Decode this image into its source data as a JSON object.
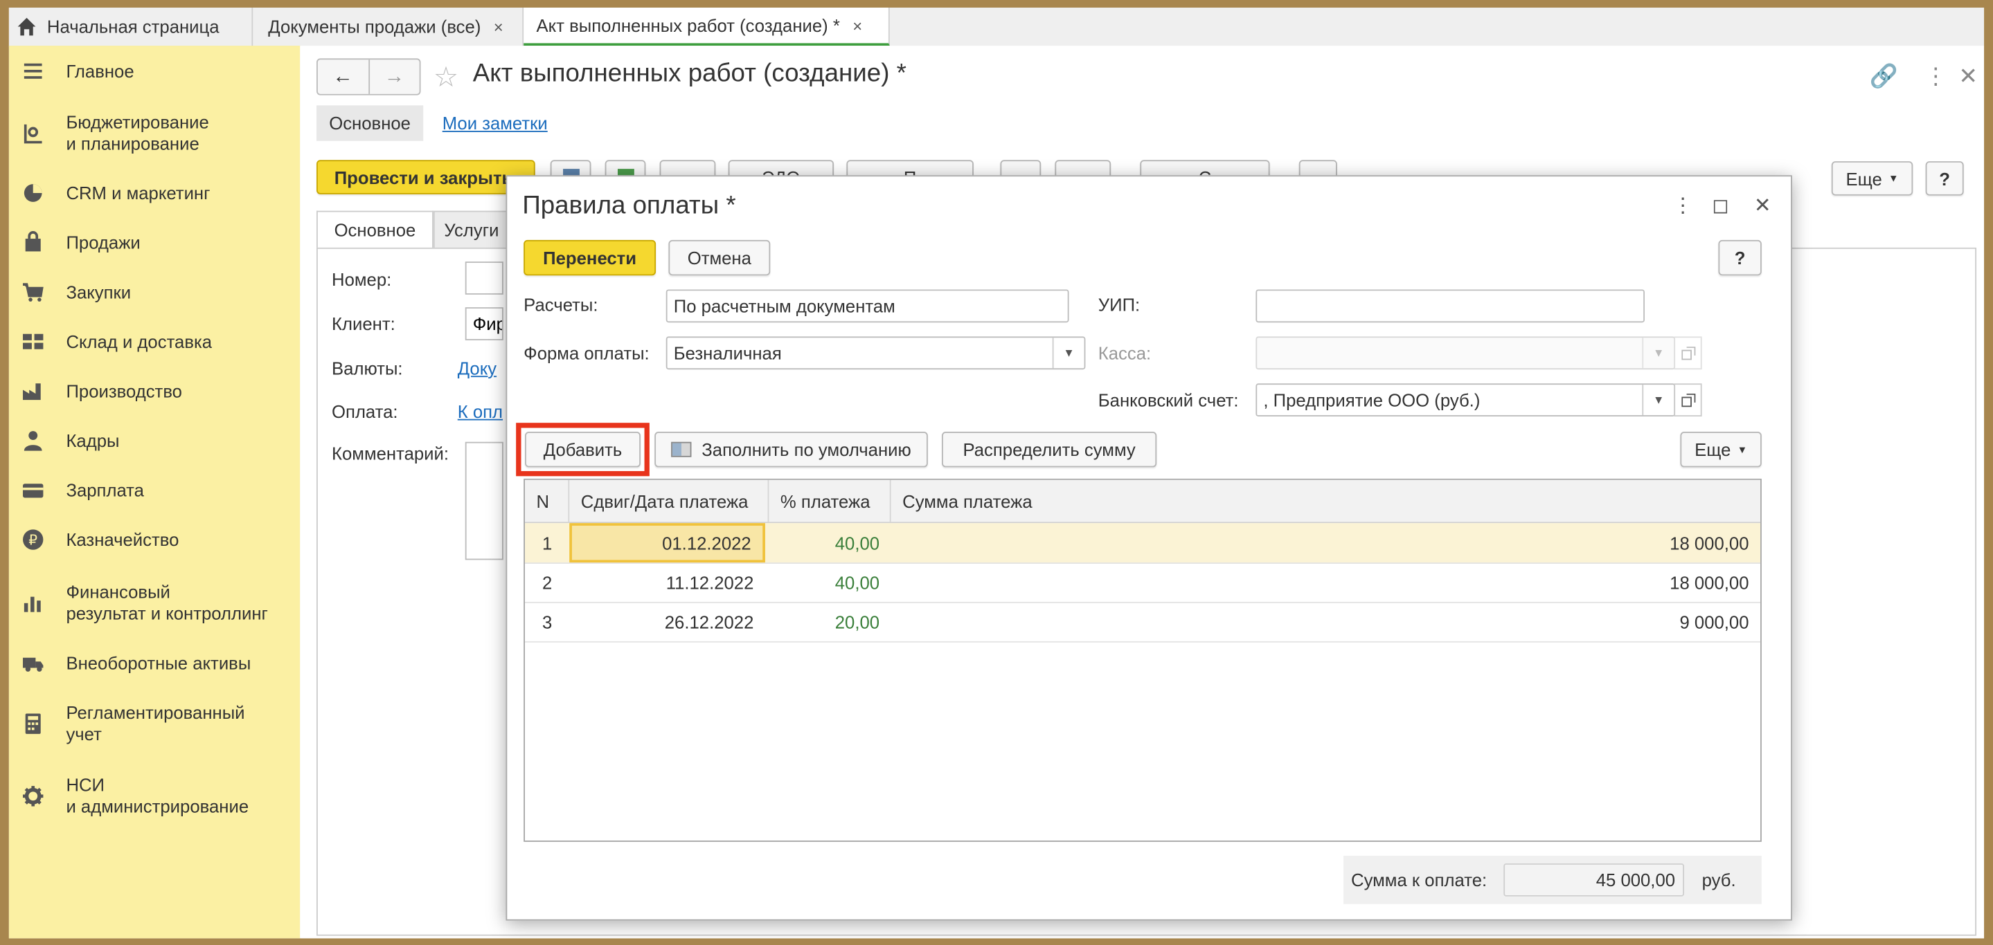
{
  "tabs": [
    {
      "label": "Начальная страница"
    },
    {
      "label": "Документы продажи (все)",
      "close": "×"
    },
    {
      "label": "Акт выполненных работ (создание) *",
      "close": "×"
    }
  ],
  "sidebar": {
    "items": [
      {
        "label": "Главное",
        "icon": "menu-icon"
      },
      {
        "label": "Бюджетирование\nи планирование",
        "icon": "budget-icon"
      },
      {
        "label": "CRM и маркетинг",
        "icon": "pie-chart-icon"
      },
      {
        "label": "Продажи",
        "icon": "bag-icon"
      },
      {
        "label": "Закупки",
        "icon": "cart-icon"
      },
      {
        "label": "Склад и доставка",
        "icon": "warehouse-icon"
      },
      {
        "label": "Производство",
        "icon": "factory-icon"
      },
      {
        "label": "Кадры",
        "icon": "person-icon"
      },
      {
        "label": "Зарплата",
        "icon": "card-icon"
      },
      {
        "label": "Казначейство",
        "icon": "ruble-icon"
      },
      {
        "label": "Финансовый\nрезультат и контроллинг",
        "icon": "bar-chart-icon"
      },
      {
        "label": "Внеоборотные активы",
        "icon": "truck-icon"
      },
      {
        "label": "Регламентированный\nучет",
        "icon": "calculator-icon"
      },
      {
        "label": "НСИ\nи администрирование",
        "icon": "gear-icon"
      }
    ]
  },
  "document": {
    "title": "Акт выполненных работ (создание) *",
    "subtabs": {
      "main": "Основное",
      "notes": "Мои заметки"
    },
    "post_and_close": "Провести и закрыть",
    "more": "Еще",
    "help": "?",
    "form_tabs": [
      "Основное",
      "Услуги"
    ],
    "fields": {
      "number_label": "Номер:",
      "client_label": "Клиент:",
      "client_value": "Фир",
      "currency_label": "Валюты:",
      "currency_value": "Доку",
      "payment_label": "Оплата:",
      "payment_value": "К опл",
      "comment_label": "Комментарий:"
    },
    "toolbar_partial": {
      "edo": "ЭДО",
      "print": "П",
      "create": "С"
    }
  },
  "modal": {
    "title": "Правила оплаты *",
    "transfer": "Перенести",
    "cancel": "Отмена",
    "help": "?",
    "settlements_label": "Расчеты:",
    "settlements_value": "По расчетным документам",
    "uip_label": "УИП:",
    "uip_value": "",
    "payment_form_label": "Форма оплаты:",
    "payment_form_value": "Безналичная",
    "cash_label": "Касса:",
    "cash_value": "",
    "bank_label": "Банковский счет:",
    "bank_value": ", Предприятие ООО (руб.)",
    "add_button": "Добавить",
    "fill_default": "Заполнить по умолчанию",
    "distribute": "Распределить сумму",
    "more": "Еще",
    "table": {
      "headers": [
        "N",
        "Сдвиг/Дата платежа",
        "% платежа",
        "Сумма платежа"
      ],
      "rows": [
        {
          "n": "1",
          "date": "01.12.2022",
          "percent": "40,00",
          "sum": "18 000,00"
        },
        {
          "n": "2",
          "date": "11.12.2022",
          "percent": "40,00",
          "sum": "18 000,00"
        },
        {
          "n": "3",
          "date": "26.12.2022",
          "percent": "20,00",
          "sum": "9 000,00"
        }
      ],
      "selected_row": 0
    },
    "total_label": "Сумма к оплате:",
    "total_value": "45 000,00",
    "currency": "руб."
  },
  "colors": {
    "sidebar_bg": "#fbf0a3",
    "accent_yellow": "#f5d82f",
    "highlight_red": "#e8341c",
    "link_blue": "#1b6cbd",
    "percent_green": "#3a7f3a"
  }
}
